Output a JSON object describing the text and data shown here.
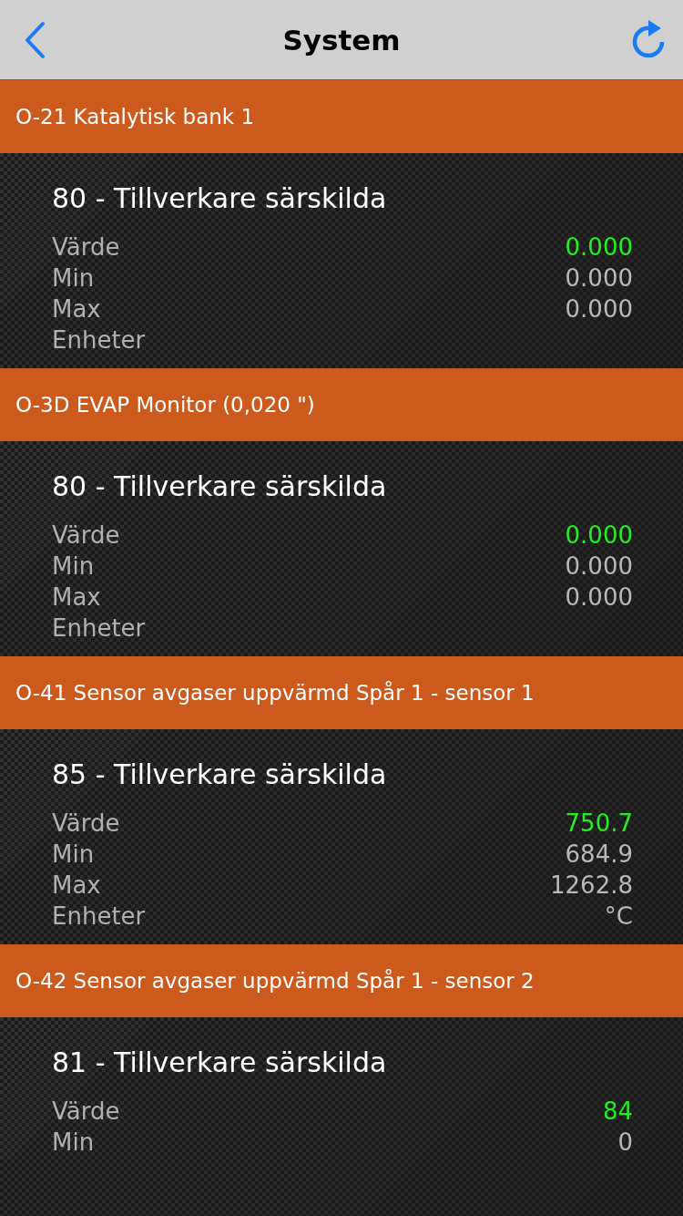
{
  "nav": {
    "title": "System"
  },
  "sections": [
    {
      "header": "O-21 Katalytisk bank 1",
      "title": "80 - Tillverkare särskilda",
      "rows": [
        {
          "label": "Värde",
          "value": "0.000",
          "kind": "current"
        },
        {
          "label": "Min",
          "value": "0.000",
          "kind": "stat"
        },
        {
          "label": "Max",
          "value": "0.000",
          "kind": "stat"
        },
        {
          "label": "Enheter"
        }
      ]
    },
    {
      "header": "O-3D EVAP Monitor (0,020 \")",
      "title": "80 - Tillverkare särskilda",
      "rows": [
        {
          "label": "Värde",
          "value": "0.000",
          "kind": "current"
        },
        {
          "label": "Min",
          "value": "0.000",
          "kind": "stat"
        },
        {
          "label": "Max",
          "value": "0.000",
          "kind": "stat"
        },
        {
          "label": "Enheter"
        }
      ]
    },
    {
      "header": "O-41 Sensor avgaser uppvärmd Spår 1 - sensor 1",
      "title": "85 - Tillverkare särskilda",
      "rows": [
        {
          "label": "Värde",
          "value": "750.7",
          "kind": "current"
        },
        {
          "label": "Min",
          "value": "684.9",
          "kind": "stat"
        },
        {
          "label": "Max",
          "value": "1262.8",
          "kind": "stat"
        },
        {
          "label": "Enheter",
          "value": "°C",
          "kind": "stat"
        }
      ]
    },
    {
      "header": "O-42 Sensor avgaser uppvärmd Spår 1 - sensor 2",
      "title": "81 - Tillverkare särskilda",
      "rows": [
        {
          "label": "Värde",
          "value": "84",
          "kind": "current"
        },
        {
          "label": "Min",
          "value": "0",
          "kind": "stat"
        }
      ]
    }
  ]
}
